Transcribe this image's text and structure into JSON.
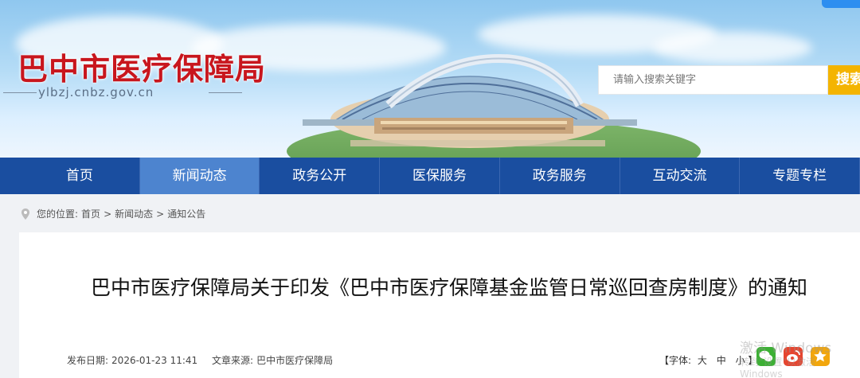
{
  "header": {
    "site_title": "巴中市医疗保障局",
    "domain": "ylbzj.cnbz.gov.cn"
  },
  "search": {
    "placeholder": "请输入搜索关键字",
    "button_label": "搜索"
  },
  "nav": {
    "items": [
      "首页",
      "新闻动态",
      "政务公开",
      "医保服务",
      "政务服务",
      "互动交流",
      "专题专栏"
    ],
    "active_index": 1
  },
  "breadcrumb": {
    "prefix": "您的位置:",
    "items": [
      "首页",
      "新闻动态",
      "通知公告"
    ],
    "separator": ">"
  },
  "article": {
    "title": "巴中市医疗保障局关于印发《巴中市医疗保障基金监管日常巡回查房制度》的通知",
    "publish_label": "发布日期:",
    "publish_date": "2026-01-23 11:41",
    "source_label": "文章来源:",
    "source": "巴中市医疗保障局",
    "font_size": {
      "open": "【字体:",
      "large": "大",
      "medium": "中",
      "small": "小",
      "close": "】"
    }
  },
  "share": {
    "icons": [
      "wechat-icon",
      "weibo-icon",
      "qzone-icon"
    ],
    "colors": [
      "#3cb034",
      "#e6452f",
      "#f2a60c"
    ]
  },
  "watermark": {
    "line1": "激活 Windows",
    "line2": "转到\"设置\"以激活 Windows"
  },
  "colors": {
    "nav_bg": "#1a4ea0",
    "nav_active": "#4d84cf",
    "title_red": "#c8161d",
    "search_button": "#f4b400"
  }
}
